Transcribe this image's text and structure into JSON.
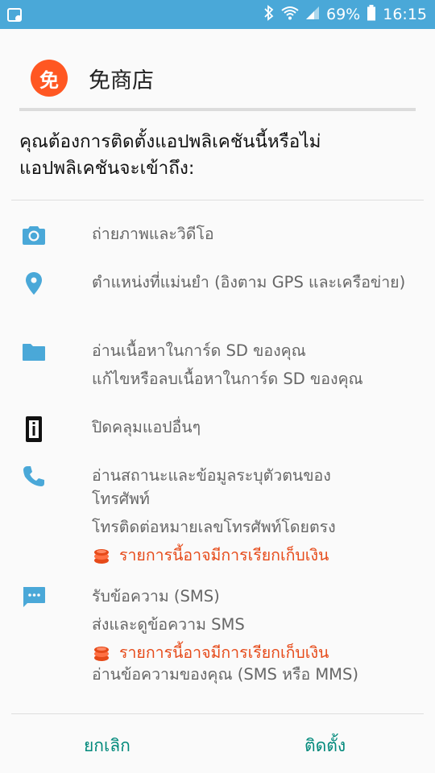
{
  "status_bar": {
    "battery_percent": "69%",
    "time": "16:15",
    "icons": [
      "notification-icon",
      "bluetooth-icon",
      "wifi-icon",
      "signal-icon",
      "battery-icon"
    ]
  },
  "app": {
    "icon_glyph": "免",
    "name": "免商店",
    "icon_color": "#ff5722"
  },
  "question": "คุณต้องการติดตั้งแอปพลิเคชันนี้หรือไม่ แอปพลิเคชันจะเข้าถึง:",
  "permissions": [
    {
      "icon": "camera-icon",
      "lines": [
        "ถ่ายภาพและวิดีโอ"
      ]
    },
    {
      "icon": "location-icon",
      "lines": [
        "ตำแหน่งที่แม่นยำ (อิงตาม GPS และเครือข่าย)"
      ]
    },
    {
      "icon": "folder-icon",
      "lines": [
        "อ่านเนื้อหาในการ์ด SD ของคุณ",
        "แก้ไขหรือลบเนื้อหาในการ์ด SD ของคุณ"
      ]
    },
    {
      "icon": "device-info-icon",
      "lines": [
        "ปิดคลุมแอปอื่นๆ"
      ]
    },
    {
      "icon": "phone-icon",
      "lines": [
        "อ่านสถานะและข้อมูลระบุตัวตนของโทรศัพท์",
        "โทรติดต่อหมายเลขโทรศัพท์โดยตรง"
      ],
      "charge": "รายการนี้อาจมีการเรียกเก็บเงิน"
    },
    {
      "icon": "sms-icon",
      "lines": [
        "รับข้อความ (SMS)",
        "ส่งและดูข้อความ SMS"
      ],
      "charge": "รายการนี้อาจมีการเรียกเก็บเงิน",
      "lines_after": [
        "อ่านข้อความของคุณ (SMS หรือ MMS)"
      ]
    }
  ],
  "buttons": {
    "cancel": "ยกเลิก",
    "install": "ติดตั้ง"
  },
  "colors": {
    "status_bar": "#4aa8d8",
    "icon_blue": "#4aa8d8",
    "charge_text": "#e64a19",
    "button_text": "#00897b"
  }
}
